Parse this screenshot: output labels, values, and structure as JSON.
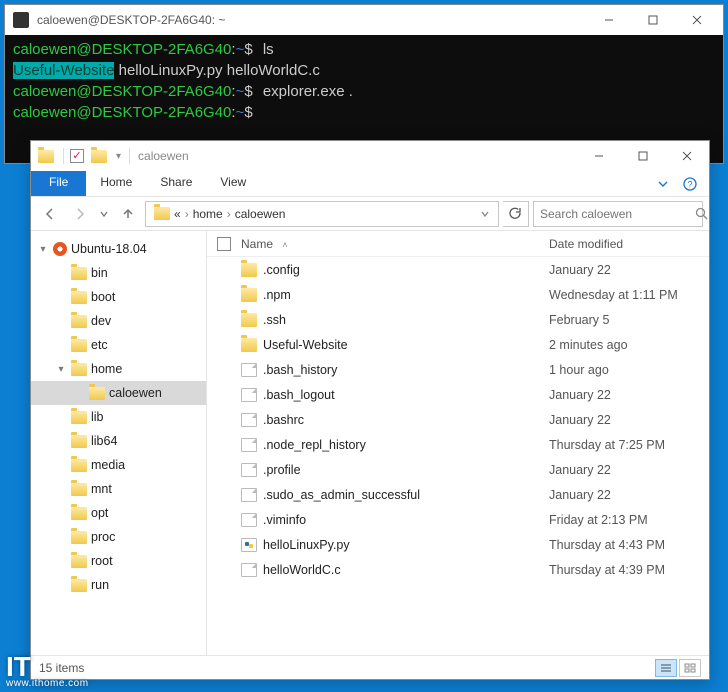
{
  "terminal": {
    "title": "caloewen@DESKTOP-2FA6G40: ~",
    "prompt_user": "caloewen@DESKTOP-2FA6G40",
    "prompt_sep": ":",
    "prompt_path": "~",
    "prompt_end": "$",
    "cmd1": "ls",
    "out_hl": "Useful-Website",
    "out_rest": "   helloLinuxPy.py  helloWorldC.c",
    "cmd2": "explorer.exe .",
    "cmd3": ""
  },
  "explorer": {
    "title": "caloewen",
    "ribbon": {
      "file": "File",
      "home": "Home",
      "share": "Share",
      "view": "View"
    },
    "breadcrumb": {
      "seg1": "«",
      "seg2": "home",
      "seg3": "caloewen"
    },
    "search_placeholder": "Search caloewen",
    "columns": {
      "name": "Name",
      "date": "Date modified"
    },
    "sidebar": [
      {
        "label": "Ubuntu-18.04",
        "depth": 0,
        "expanded": true,
        "ubuntu": true
      },
      {
        "label": "bin",
        "depth": 1
      },
      {
        "label": "boot",
        "depth": 1
      },
      {
        "label": "dev",
        "depth": 1
      },
      {
        "label": "etc",
        "depth": 1
      },
      {
        "label": "home",
        "depth": 1,
        "expanded": true
      },
      {
        "label": "caloewen",
        "depth": 2,
        "selected": true
      },
      {
        "label": "lib",
        "depth": 1
      },
      {
        "label": "lib64",
        "depth": 1
      },
      {
        "label": "media",
        "depth": 1
      },
      {
        "label": "mnt",
        "depth": 1
      },
      {
        "label": "opt",
        "depth": 1
      },
      {
        "label": "proc",
        "depth": 1
      },
      {
        "label": "root",
        "depth": 1
      },
      {
        "label": "run",
        "depth": 1
      }
    ],
    "files": [
      {
        "name": ".config",
        "type": "folder",
        "date": "January 22"
      },
      {
        "name": ".npm",
        "type": "folder",
        "date": "Wednesday at 1:11 PM"
      },
      {
        "name": ".ssh",
        "type": "folder",
        "date": "February 5"
      },
      {
        "name": "Useful-Website",
        "type": "folder",
        "date": "2 minutes ago"
      },
      {
        "name": ".bash_history",
        "type": "file",
        "date": "1 hour ago"
      },
      {
        "name": ".bash_logout",
        "type": "file",
        "date": "January 22"
      },
      {
        "name": ".bashrc",
        "type": "file",
        "date": "January 22"
      },
      {
        "name": ".node_repl_history",
        "type": "file",
        "date": "Thursday at 7:25 PM"
      },
      {
        "name": ".profile",
        "type": "file",
        "date": "January 22"
      },
      {
        "name": ".sudo_as_admin_successful",
        "type": "file",
        "date": "January 22"
      },
      {
        "name": ".viminfo",
        "type": "file",
        "date": "Friday at 2:13 PM"
      },
      {
        "name": "helloLinuxPy.py",
        "type": "py",
        "date": "Thursday at 4:43 PM"
      },
      {
        "name": "helloWorldC.c",
        "type": "file",
        "date": "Thursday at 4:39 PM"
      }
    ],
    "status": "15 items"
  },
  "watermark": {
    "big": "IT",
    "url": "www.ithome.com"
  }
}
